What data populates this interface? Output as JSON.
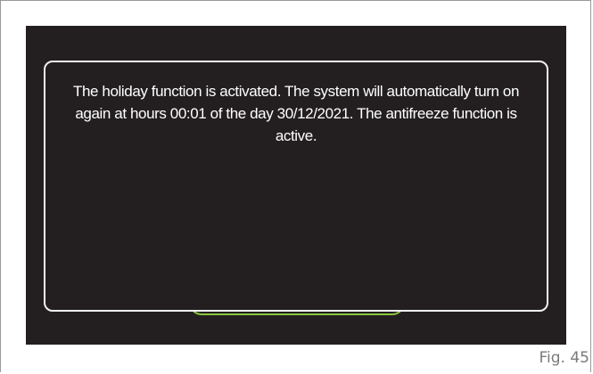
{
  "dialog": {
    "message": "The holiday function is activated. The system will automatically turn on again at hours 00:01 of the day 30/12/2021. The antifreeze function is active."
  },
  "figure": {
    "label": "Fig. 45"
  },
  "colors": {
    "screen_background": "#231f20",
    "dialog_border": "#f2f2f2",
    "button_accent": "#8cc63f",
    "text": "#ffffff"
  }
}
